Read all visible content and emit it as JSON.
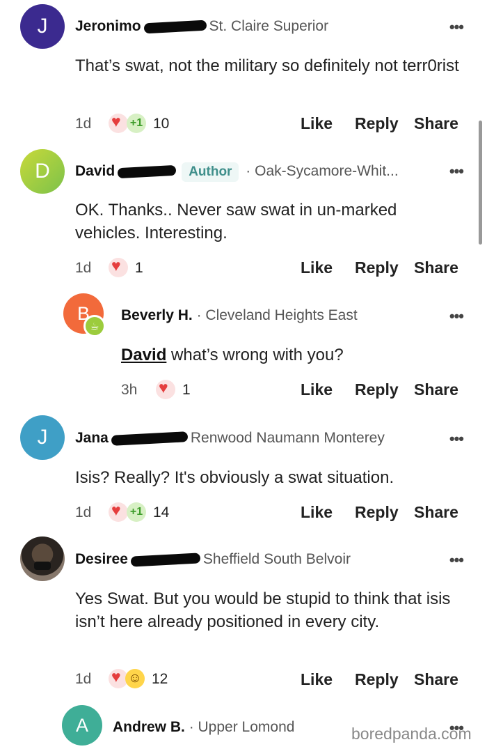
{
  "comments": [
    {
      "avatar_letter": "J",
      "avatar_color": "#3b2a8f",
      "name": "Jeronimo",
      "neighborhood": "St. Claire Superior",
      "text": "That’s swat, not the military so definitely not terr0rist",
      "time": "1d",
      "reactions": [
        "heart-icon",
        "plus-one-icon"
      ],
      "reaction_count": "10"
    },
    {
      "avatar_letter": "D",
      "avatar_color": "#9acd32",
      "name": "David",
      "badge": "Author",
      "neighborhood": "· Oak-Sycamore-Whit...",
      "text": "OK. Thanks.. Never saw swat in un-marked vehicles. Interesting.",
      "time": "1d",
      "reactions": [
        "heart-icon"
      ],
      "reaction_count": "1"
    },
    {
      "avatar_letter": "B",
      "avatar_color": "#f26a3b",
      "name": "Beverly H.",
      "neighborhood": "· Cleveland Heights East",
      "mention": "David",
      "text": " what’s wrong with you?",
      "time": "3h",
      "reactions": [
        "heart-icon"
      ],
      "reaction_count": "1"
    },
    {
      "avatar_letter": "J",
      "avatar_color": "#3f9fc6",
      "name": "Jana",
      "neighborhood": "Renwood Naumann Monterey",
      "text": "Isis?  Really?  It's obviously a swat situation.",
      "time": "1d",
      "reactions": [
        "heart-icon",
        "plus-one-icon"
      ],
      "reaction_count": "14"
    },
    {
      "name": "Desiree",
      "neighborhood": "Sheffield South Belvoir",
      "text": "Yes Swat. But you would be stupid to think that isis isn’t here already positioned in every city.",
      "time": "1d",
      "reactions": [
        "heart-icon",
        "laugh-icon"
      ],
      "reaction_count": "12"
    },
    {
      "avatar_letter": "A",
      "avatar_color": "#3fae97",
      "name": "Andrew B.",
      "neighborhood": "· Upper Lomond"
    }
  ],
  "actions": {
    "like": "Like",
    "reply": "Reply",
    "share": "Share"
  },
  "more_glyph": "•••",
  "plus_one": "+1",
  "watermark": "boredpanda.com"
}
